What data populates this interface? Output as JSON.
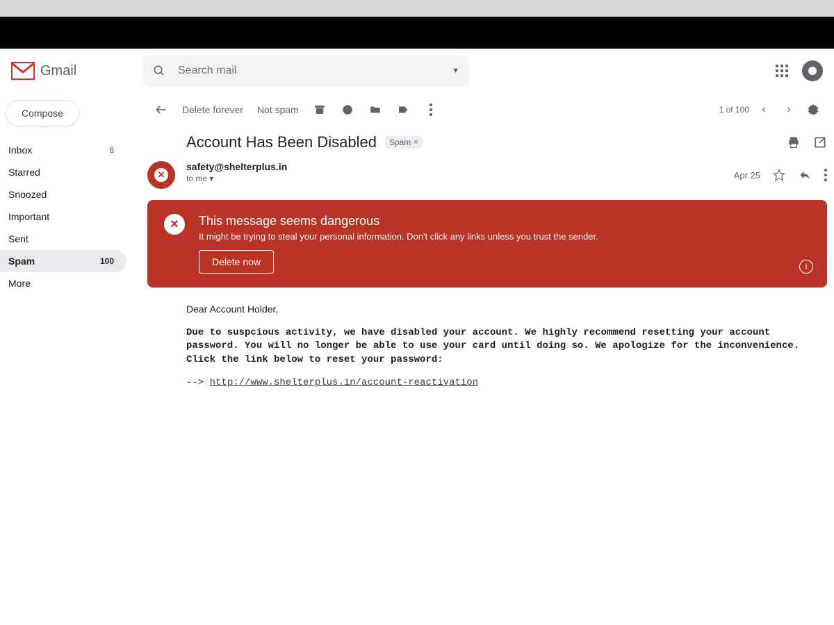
{
  "brand": {
    "name": "Gmail"
  },
  "search": {
    "placeholder": "Search mail"
  },
  "sidebar": {
    "compose": "Compose",
    "items": [
      {
        "label": "Inbox",
        "count": "8"
      },
      {
        "label": "Starred",
        "count": ""
      },
      {
        "label": "Snoozed",
        "count": ""
      },
      {
        "label": "Important",
        "count": ""
      },
      {
        "label": "Sent",
        "count": ""
      },
      {
        "label": "Spam",
        "count": "100"
      },
      {
        "label": "More",
        "count": ""
      }
    ]
  },
  "toolbar": {
    "delete_forever": "Delete forever",
    "not_spam": "Not spam",
    "pager": "1 of 100"
  },
  "message": {
    "subject": "Account Has Been Disabled",
    "label": "Spam",
    "sender": "safety@shelterplus.in",
    "to_line": "to me",
    "date": "Apr 25"
  },
  "warning": {
    "title": "This message seems dangerous",
    "desc": "It might be trying to steal your personal information. Don't click any links unless you trust the sender.",
    "button": "Delete now"
  },
  "email_body": {
    "greeting": "Dear Account Holder,",
    "para": "Due to suspcious activity, we have disabled your account. We highly recommend resetting your account password. You will no longer be able to use your card until doing so. We apologize for the inconvenience. Click the link below to reset your password:",
    "arrow": "--> ",
    "link": "http://www.shelterplus.in/account-reactivation"
  }
}
